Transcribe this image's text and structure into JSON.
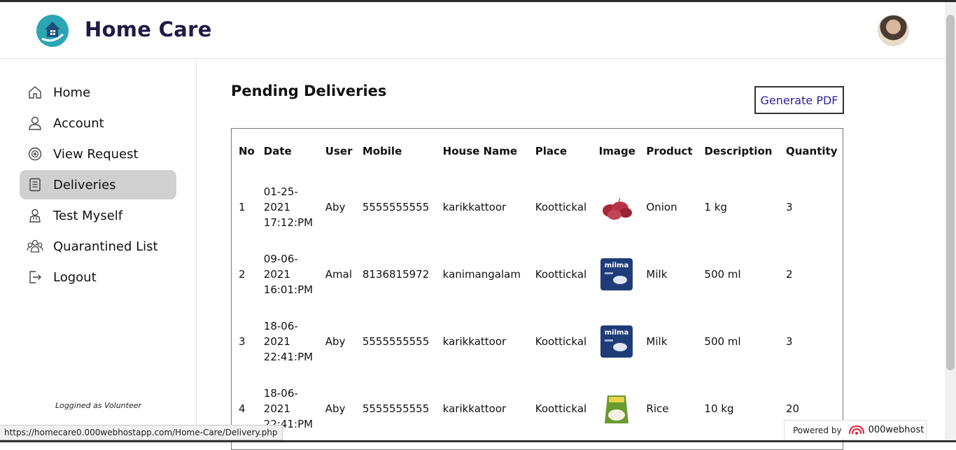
{
  "header": {
    "brand": "Home Care"
  },
  "sidebar": {
    "items": [
      {
        "label": "Home",
        "icon": "home-icon"
      },
      {
        "label": "Account",
        "icon": "user-icon"
      },
      {
        "label": "View Request",
        "icon": "medical-request-icon"
      },
      {
        "label": "Deliveries",
        "icon": "document-icon",
        "active": true
      },
      {
        "label": "Test Myself",
        "icon": "doctor-icon"
      },
      {
        "label": "Quarantined List",
        "icon": "group-icon"
      },
      {
        "label": "Logout",
        "icon": "logout-icon"
      }
    ],
    "logged_as": "Loggined as Volunteer"
  },
  "main": {
    "title": "Pending Deliveries",
    "pdf_button": "Generate PDF",
    "columns": [
      "No",
      "Date",
      "User",
      "Mobile",
      "House Name",
      "Place",
      "Image",
      "Product",
      "Description",
      "Quantity"
    ],
    "rows": [
      {
        "no": "1",
        "date": "01-25-2021 17:12:PM",
        "user": "Aby",
        "mobile": "5555555555",
        "house": "karikkattoor",
        "place": "Koottickal",
        "image": "onion-image",
        "product": "Onion",
        "description": "1 kg",
        "quantity": "3"
      },
      {
        "no": "2",
        "date": "09-06-2021 16:01:PM",
        "user": "Amal",
        "mobile": "8136815972",
        "house": "kanimangalam",
        "place": "Koottickal",
        "image": "milk-image",
        "product": "Milk",
        "description": "500 ml",
        "quantity": "2"
      },
      {
        "no": "3",
        "date": "18-06-2021 22:41:PM",
        "user": "Aby",
        "mobile": "5555555555",
        "house": "karikkattoor",
        "place": "Koottickal",
        "image": "milk-image",
        "product": "Milk",
        "description": "500 ml",
        "quantity": "3"
      },
      {
        "no": "4",
        "date": "18-06-2021 22:41:PM",
        "user": "Aby",
        "mobile": "5555555555",
        "house": "karikkattoor",
        "place": "Koottickal",
        "image": "rice-image",
        "product": "Rice",
        "description": "10 kg",
        "quantity": "20"
      }
    ],
    "milk_pack_text": "milma"
  },
  "status_bar": {
    "url": "https://homecare0.000webhostapp.com/Home-Care/Delivery.php"
  },
  "badge": {
    "powered_by": "Powered by",
    "host": "000webhost"
  },
  "colors": {
    "brand_text": "#221a46",
    "logo_teal": "#2aa6b4",
    "active_nav": "#d0d0d0",
    "pdf_text": "#2a1fa0"
  }
}
